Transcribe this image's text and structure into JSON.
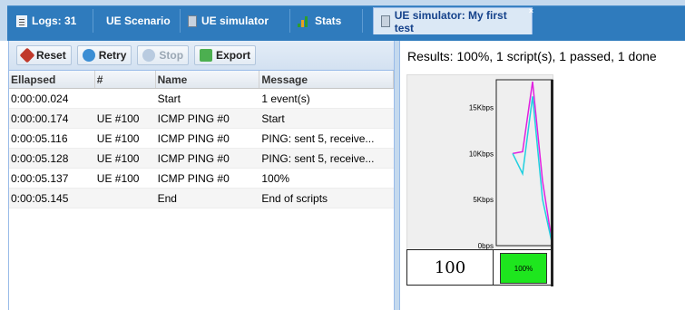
{
  "tabs": [
    {
      "label": "Logs: 31",
      "icon": "log-icon"
    },
    {
      "label": "UE Scenario",
      "icon": ""
    },
    {
      "label": "UE simulator",
      "icon": "calculator-icon"
    },
    {
      "label": "Stats",
      "icon": "bar-chart-icon"
    },
    {
      "label": "UE simulator: My first test",
      "icon": "calculator-icon",
      "active": true,
      "close": "×"
    }
  ],
  "toolbar": {
    "reset_label": "Reset",
    "retry_label": "Retry",
    "stop_label": "Stop",
    "export_label": "Export"
  },
  "grid": {
    "columns": [
      "Ellapsed",
      "#",
      "Name",
      "Message"
    ],
    "rows": [
      [
        "0:00:00.024",
        "",
        "Start",
        "1 event(s)"
      ],
      [
        "0:00:00.174",
        "UE #100",
        "ICMP PING #0",
        "Start"
      ],
      [
        "0:00:05.116",
        "UE #100",
        "ICMP PING #0",
        "PING: sent 5, receive..."
      ],
      [
        "0:00:05.128",
        "UE #100",
        "ICMP PING #0",
        "PING: sent 5, receive..."
      ],
      [
        "0:00:05.137",
        "UE #100",
        "ICMP PING #0",
        "100%"
      ],
      [
        "0:00:05.145",
        "",
        "End",
        "End of scripts"
      ]
    ]
  },
  "results": {
    "summary": "Results: 100%, 1 script(s), 1 passed, 1 done",
    "count": "100",
    "progress_label": "100%",
    "progress_fraction": 1.0
  },
  "chart_data": {
    "type": "line",
    "ytick_labels": [
      "0bps",
      "5Kbps",
      "10Kbps",
      "15Kbps"
    ],
    "ylim": [
      0,
      18000
    ],
    "x": [
      0,
      1,
      2,
      3,
      4
    ],
    "series": [
      {
        "values": [
          10000,
          10200,
          17800,
          7000,
          0
        ],
        "color": "#e020e0"
      },
      {
        "values": [
          10000,
          7800,
          16200,
          5000,
          0
        ],
        "color": "#20d0e0"
      }
    ],
    "grid": false
  }
}
